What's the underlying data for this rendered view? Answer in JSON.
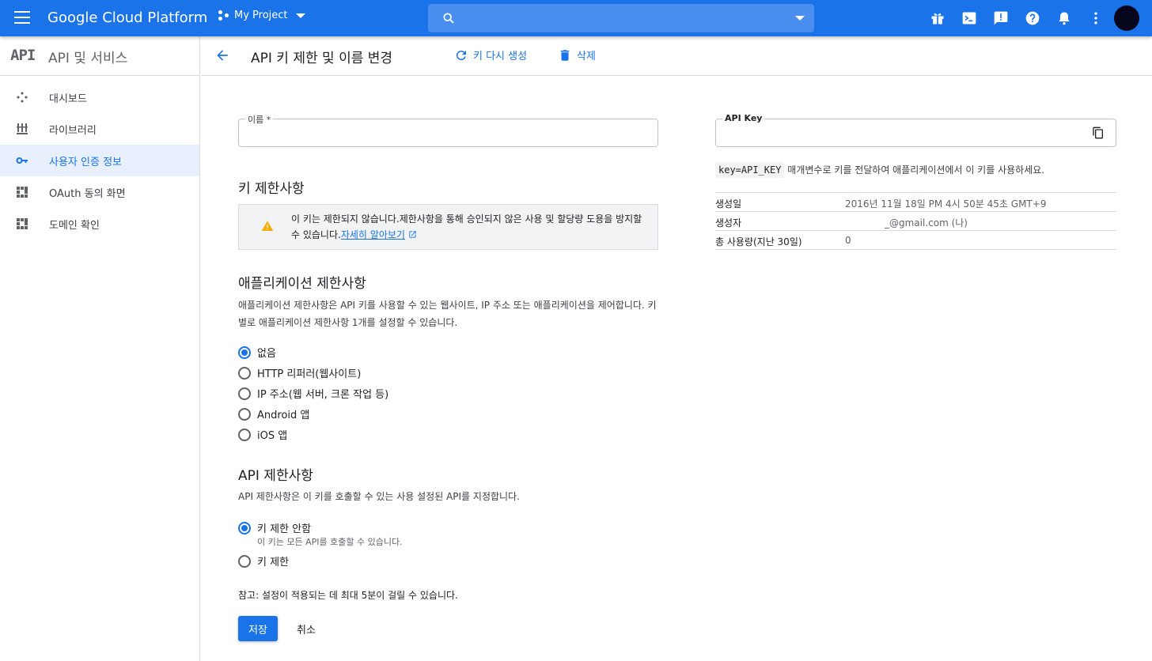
{
  "topbar": {
    "brand": "Google Cloud Platform",
    "project": "My Project",
    "search_placeholder": ""
  },
  "sidebar": {
    "logo": "API",
    "title": "API 및 서비스",
    "items": [
      {
        "label": "대시보드",
        "icon": "dashboard-icon",
        "active": false
      },
      {
        "label": "라이브러리",
        "icon": "library-icon",
        "active": false
      },
      {
        "label": "사용자 인증 정보",
        "icon": "key-icon",
        "active": true
      },
      {
        "label": "OAuth 동의 화면",
        "icon": "consent-icon",
        "active": false
      },
      {
        "label": "도메인 확인",
        "icon": "domain-icon",
        "active": false
      }
    ]
  },
  "header": {
    "title": "API 키 제한 및 이름 변경",
    "regenerate_label": "키 다시 생성",
    "delete_label": "삭제"
  },
  "form": {
    "name_label": "이름 *",
    "name_value": "",
    "key_restrictions_heading": "키 제한사항",
    "warning_text": "이 키는 제한되지 않습니다.제한사항을 통해 승인되지 않은 사용 및 할당량 도용을 방지할 수 있습니다.",
    "warning_link": "자세히 알아보기",
    "app_heading": "애플리케이션 제한사항",
    "app_desc": "애플리케이션 제한사항은 API 키를 사용할 수 있는 웹사이트, IP 주소 또는 애플리케이션을 제어합니다. 키별로 애플리케이션 제한사항 1개를 설정할 수 있습니다.",
    "app_options": [
      {
        "label": "없음",
        "selected": true
      },
      {
        "label": "HTTP 리퍼러(웹사이트)",
        "selected": false
      },
      {
        "label": "IP 주소(웹 서버, 크론 작업 등)",
        "selected": false
      },
      {
        "label": "Android 앱",
        "selected": false
      },
      {
        "label": "iOS 앱",
        "selected": false
      }
    ],
    "api_heading": "API 제한사항",
    "api_desc": "API 제한사항은 이 키를 호출할 수 있는 사용 설정된 API를 지정합니다.",
    "api_options": [
      {
        "label": "키 제한 안함",
        "sub": "이 키는 모든 API를 호출할 수 있습니다.",
        "selected": true
      },
      {
        "label": "키 제한",
        "sub": "",
        "selected": false
      }
    ],
    "note": "참고: 설정이 적용되는 데 최대 5분이 걸릴 수 있습니다.",
    "save_label": "저장",
    "cancel_label": "취소"
  },
  "key_panel": {
    "label": "API Key",
    "value": "",
    "hint_code": "key=API_KEY",
    "hint_text": " 매개변수로 키를 전달하여 애플리케이션에서 이 키를 사용하세요.",
    "rows": [
      {
        "key": "생성일",
        "value": "2016년 11월 18일 PM 4시 50분 45초 GMT+9"
      },
      {
        "key": "생성자",
        "value": "_@gmail.com (나)"
      },
      {
        "key": "총 사용량(지난 30일)",
        "value": "0"
      }
    ]
  },
  "colors": {
    "primary": "#1a73e8",
    "warning": "#f9ab00"
  }
}
